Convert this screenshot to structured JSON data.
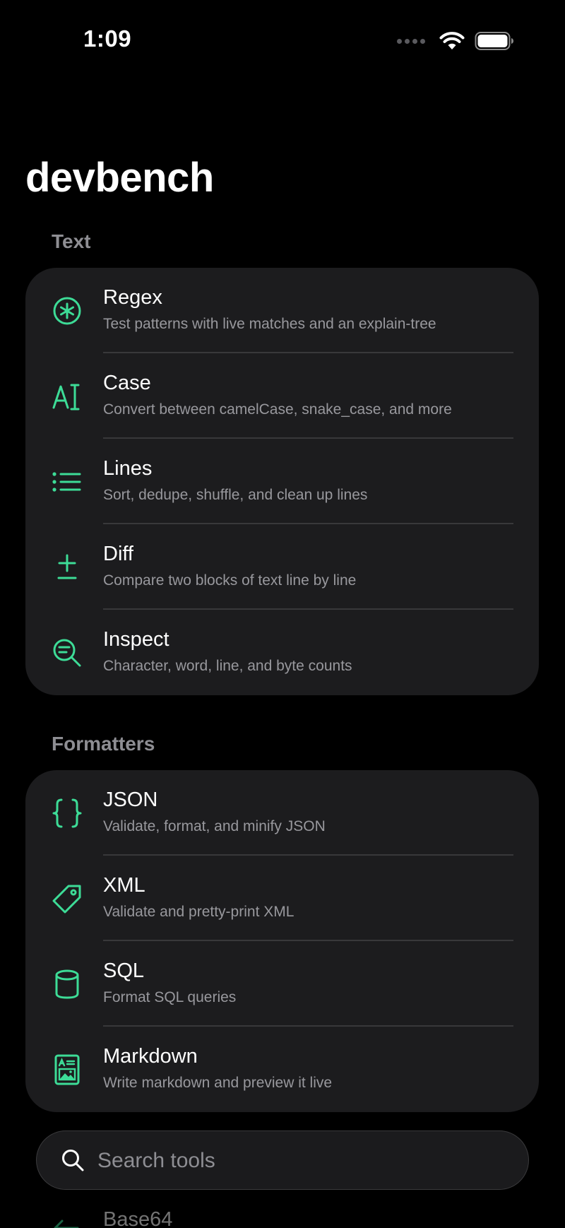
{
  "status_bar": {
    "time": "1:09"
  },
  "app": {
    "title": "devbench"
  },
  "accent_color": "#3ddc97",
  "sections": [
    {
      "header": "Text",
      "items": [
        {
          "title": "Regex",
          "subtitle": "Test patterns with live matches and an explain-tree",
          "icon": "asterisk-circle-icon"
        },
        {
          "title": "Case",
          "subtitle": "Convert between camelCase, snake_case, and more",
          "icon": "text-cursor-icon"
        },
        {
          "title": "Lines",
          "subtitle": "Sort, dedupe, shuffle, and clean up lines",
          "icon": "list-bullet-icon"
        },
        {
          "title": "Diff",
          "subtitle": "Compare two blocks of text line by line",
          "icon": "plus-minus-icon"
        },
        {
          "title": "Inspect",
          "subtitle": "Character, word, line, and byte counts",
          "icon": "magnifier-text-icon"
        }
      ]
    },
    {
      "header": "Formatters",
      "items": [
        {
          "title": "JSON",
          "subtitle": "Validate, format, and minify JSON",
          "icon": "curly-braces-icon"
        },
        {
          "title": "XML",
          "subtitle": "Validate and pretty-print XML",
          "icon": "tag-icon"
        },
        {
          "title": "SQL",
          "subtitle": "Format SQL queries",
          "icon": "cylinder-icon"
        },
        {
          "title": "Markdown",
          "subtitle": "Write markdown and preview it live",
          "icon": "document-image-icon"
        }
      ]
    }
  ],
  "search": {
    "placeholder": "Search tools"
  },
  "peek": {
    "title": "Base64",
    "icon": "arrow-left-icon"
  }
}
